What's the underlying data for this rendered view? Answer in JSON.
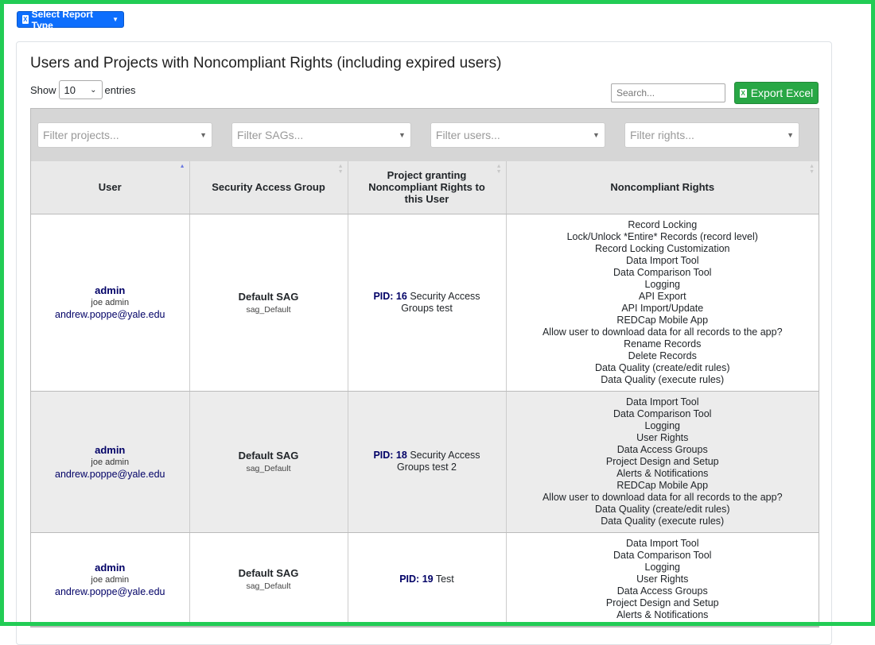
{
  "report_button": {
    "label": "Select Report Type"
  },
  "title": "Users and Projects with Noncompliant Rights (including expired users)",
  "length": {
    "show": "Show",
    "value": "10",
    "entries": "entries"
  },
  "search": {
    "placeholder": "Search..."
  },
  "export": {
    "label": "Export Excel"
  },
  "filters": {
    "projects": "Filter projects...",
    "sags": "Filter SAGs...",
    "users": "Filter users...",
    "rights": "Filter rights..."
  },
  "columns": {
    "user": "User",
    "sag": "Security Access Group",
    "project": "Project granting Noncompliant Rights to this User",
    "rights": "Noncompliant Rights"
  },
  "rows": [
    {
      "username": "admin",
      "fullname": "joe admin",
      "email": "andrew.poppe@yale.edu",
      "sag_name": "Default SAG",
      "sag_id": "sag_Default",
      "pid_label": "PID:",
      "pid": "16",
      "project": "Security Access Groups test",
      "rights": [
        "Record Locking",
        "Lock/Unlock *Entire* Records (record level)",
        "Record Locking Customization",
        "Data Import Tool",
        "Data Comparison Tool",
        "Logging",
        "API Export",
        "API Import/Update",
        "REDCap Mobile App",
        "Allow user to download data for all records to the app?",
        "Rename Records",
        "Delete Records",
        "Data Quality (create/edit rules)",
        "Data Quality (execute rules)"
      ]
    },
    {
      "username": "admin",
      "fullname": "joe admin",
      "email": "andrew.poppe@yale.edu",
      "sag_name": "Default SAG",
      "sag_id": "sag_Default",
      "pid_label": "PID:",
      "pid": "18",
      "project": "Security Access Groups test 2",
      "rights": [
        "Data Import Tool",
        "Data Comparison Tool",
        "Logging",
        "User Rights",
        "Data Access Groups",
        "Project Design and Setup",
        "Alerts & Notifications",
        "REDCap Mobile App",
        "Allow user to download data for all records to the app?",
        "Data Quality (create/edit rules)",
        "Data Quality (execute rules)"
      ]
    },
    {
      "username": "admin",
      "fullname": "joe admin",
      "email": "andrew.poppe@yale.edu",
      "sag_name": "Default SAG",
      "sag_id": "sag_Default",
      "pid_label": "PID:",
      "pid": "19",
      "project": "Test",
      "rights": [
        "Data Import Tool",
        "Data Comparison Tool",
        "Logging",
        "User Rights",
        "Data Access Groups",
        "Project Design and Setup",
        "Alerts & Notifications"
      ]
    }
  ]
}
